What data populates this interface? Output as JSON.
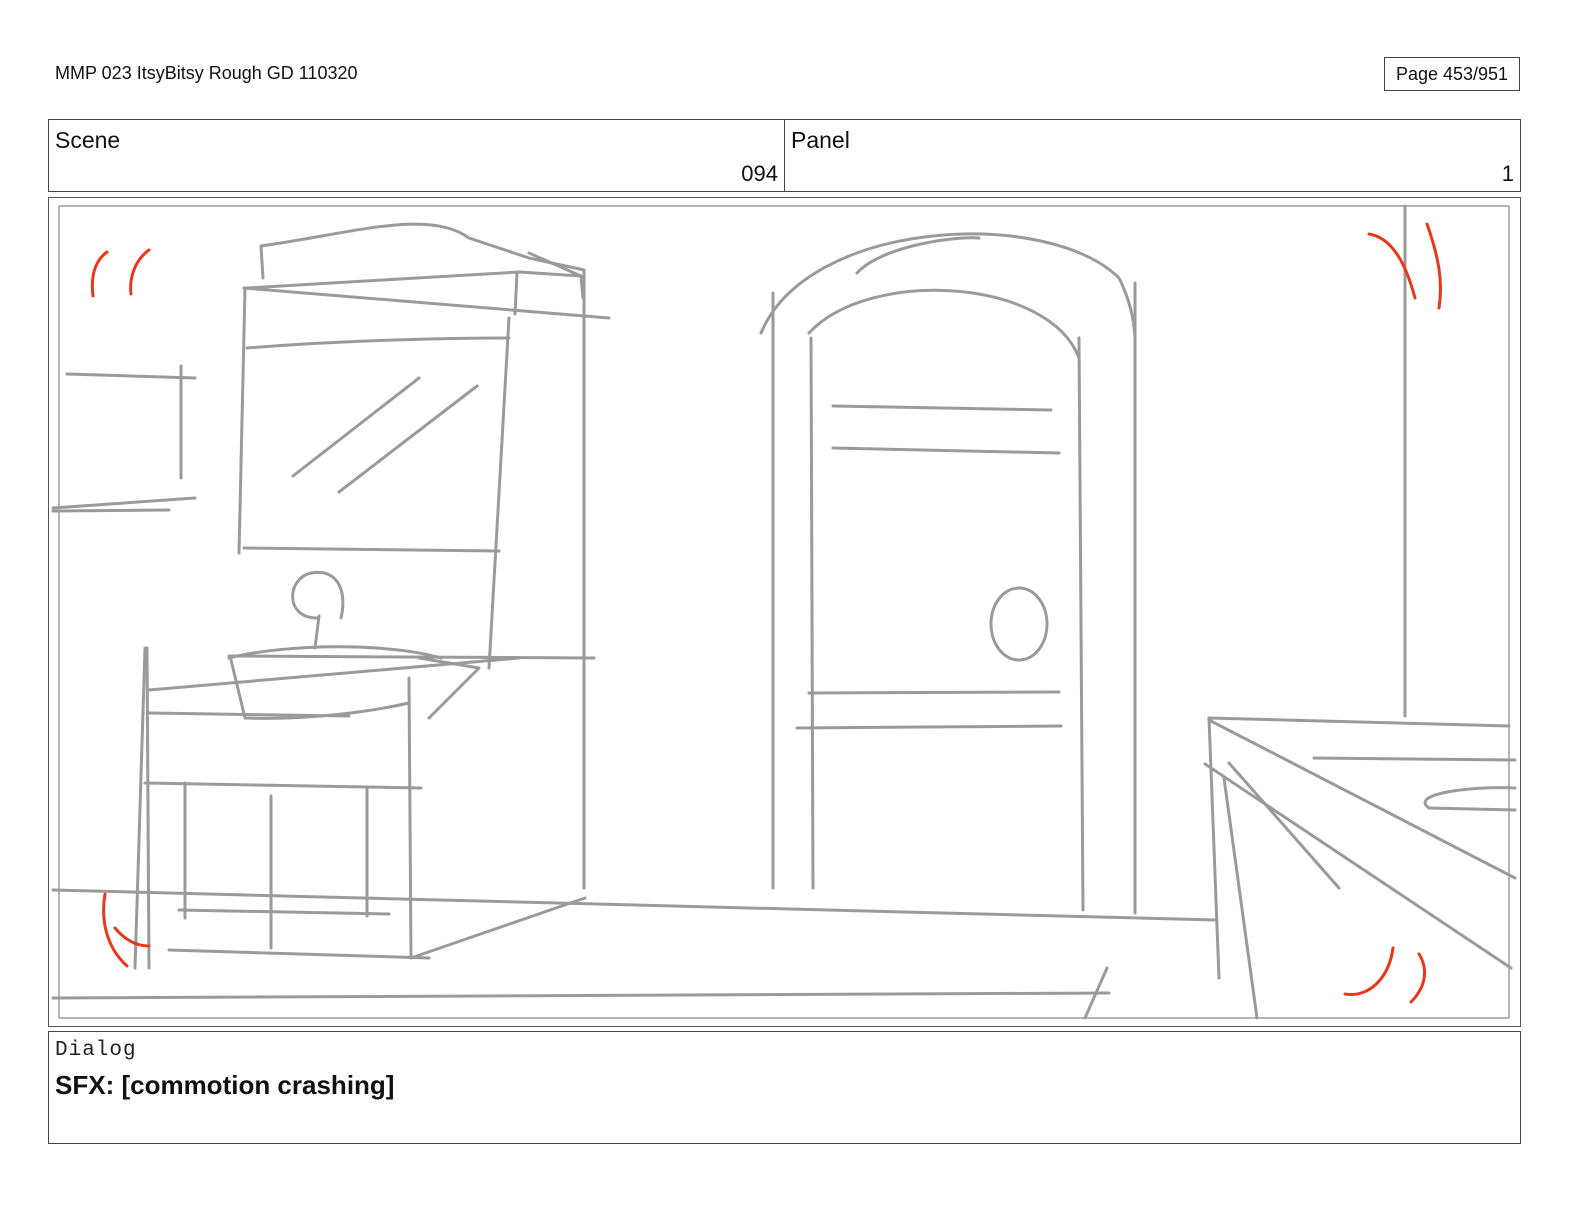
{
  "document": {
    "title": "MMP 023 ItsyBitsy Rough GD 110320",
    "page": "Page 453/951"
  },
  "header": {
    "scene_label": "Scene",
    "scene_value": "094",
    "panel_label": "Panel",
    "panel_value": "1"
  },
  "dialog": {
    "label": "Dialog",
    "text": "SFX: [commotion crashing]"
  },
  "sketch": {
    "line_color": "#9a9a9a",
    "accent_color": "#e8381c"
  }
}
